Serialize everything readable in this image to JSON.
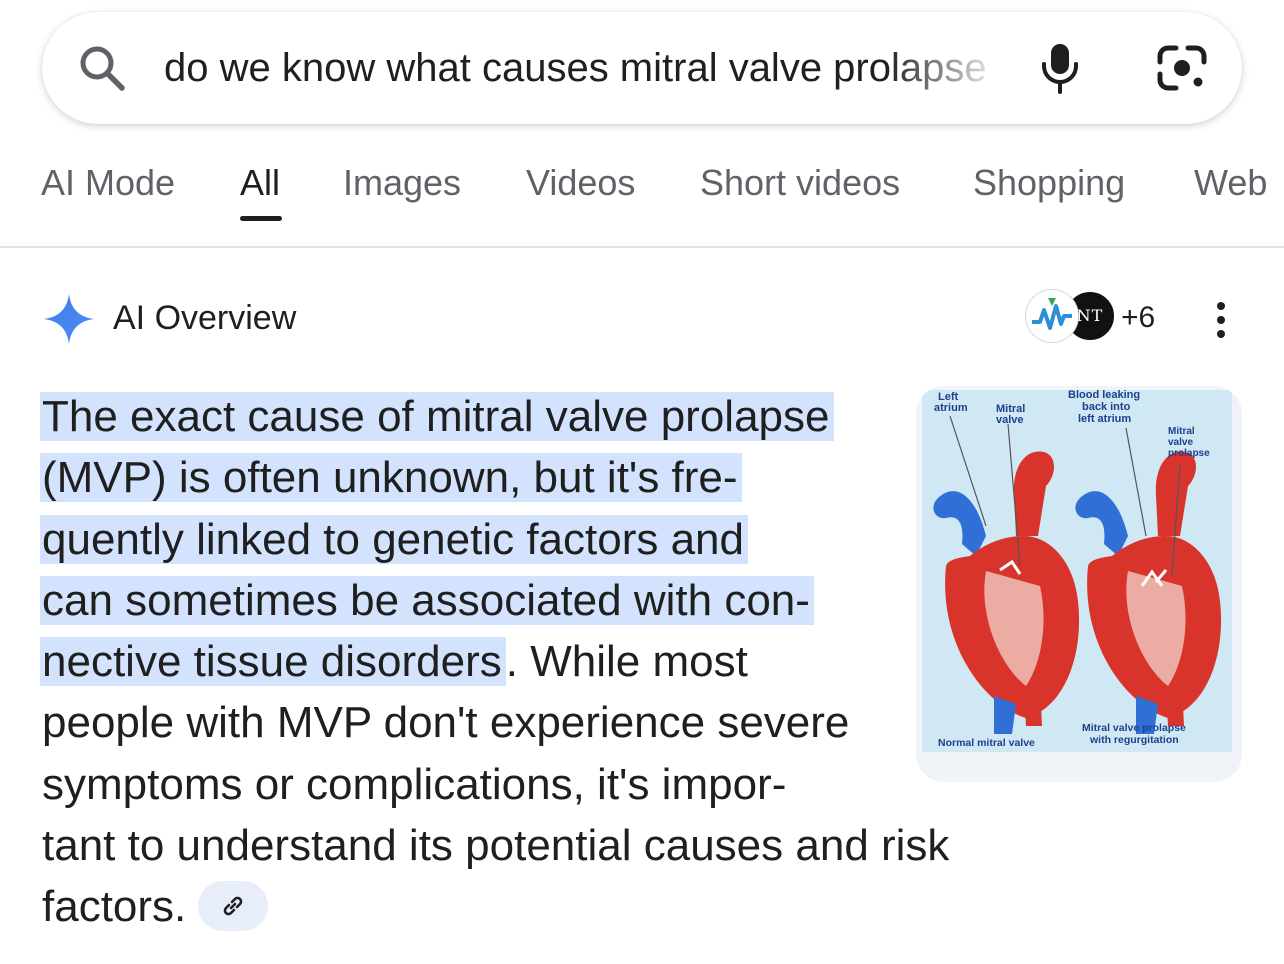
{
  "search": {
    "query": "do we know what causes mitral valve prolapse"
  },
  "tabs": [
    {
      "label": "AI Mode"
    },
    {
      "label": "All"
    },
    {
      "label": "Images"
    },
    {
      "label": "Videos"
    },
    {
      "label": "Short videos"
    },
    {
      "label": "Shopping"
    },
    {
      "label": "Web"
    }
  ],
  "active_tab": "All",
  "ai_overview": {
    "title": "AI Overview",
    "more_sources": "+6",
    "source_avatar_2": "NT",
    "text_lines": [
      {
        "hl": "The exact cause of mitral valve prolapse",
        "rest": ""
      },
      {
        "hl": "(MVP) is often unknown, but it's fre-",
        "rest": ""
      },
      {
        "hl": "quently linked to genetic factors and",
        "rest": ""
      },
      {
        "hl": "can sometimes be associated with con-",
        "rest": ""
      },
      {
        "hl": "nective tissue disorders",
        "rest": ". While most"
      },
      {
        "hl": "",
        "rest": "people with MVP don't experience severe"
      },
      {
        "hl": "",
        "rest": "symptoms or complications, it's impor-"
      },
      {
        "hl": "",
        "rest": "tant to understand its potential causes and risk"
      },
      {
        "hl": "",
        "rest": "factors."
      }
    ]
  },
  "figure": {
    "labels": {
      "left_atrium": [
        "Left",
        "atrium"
      ],
      "mitral_valve": [
        "Mitral",
        "valve"
      ],
      "blood_leaking": [
        "Blood leaking",
        "back into",
        "left atrium"
      ],
      "mvp": [
        "Mitral",
        "valve",
        "prolapse"
      ],
      "caption_left": [
        "Normal mitral valve"
      ],
      "caption_right": [
        "Mitral valve prolapse",
        "with regurgitation"
      ]
    }
  },
  "colors": {
    "highlight": "#d3e3fd",
    "text": "#1f1f1f",
    "tab_inactive": "#5f6368",
    "spark": "#4285f4",
    "figure_bg": "#cde6f2",
    "heart_red": "#d9342b",
    "vessel_blue": "#2f6fd6"
  }
}
